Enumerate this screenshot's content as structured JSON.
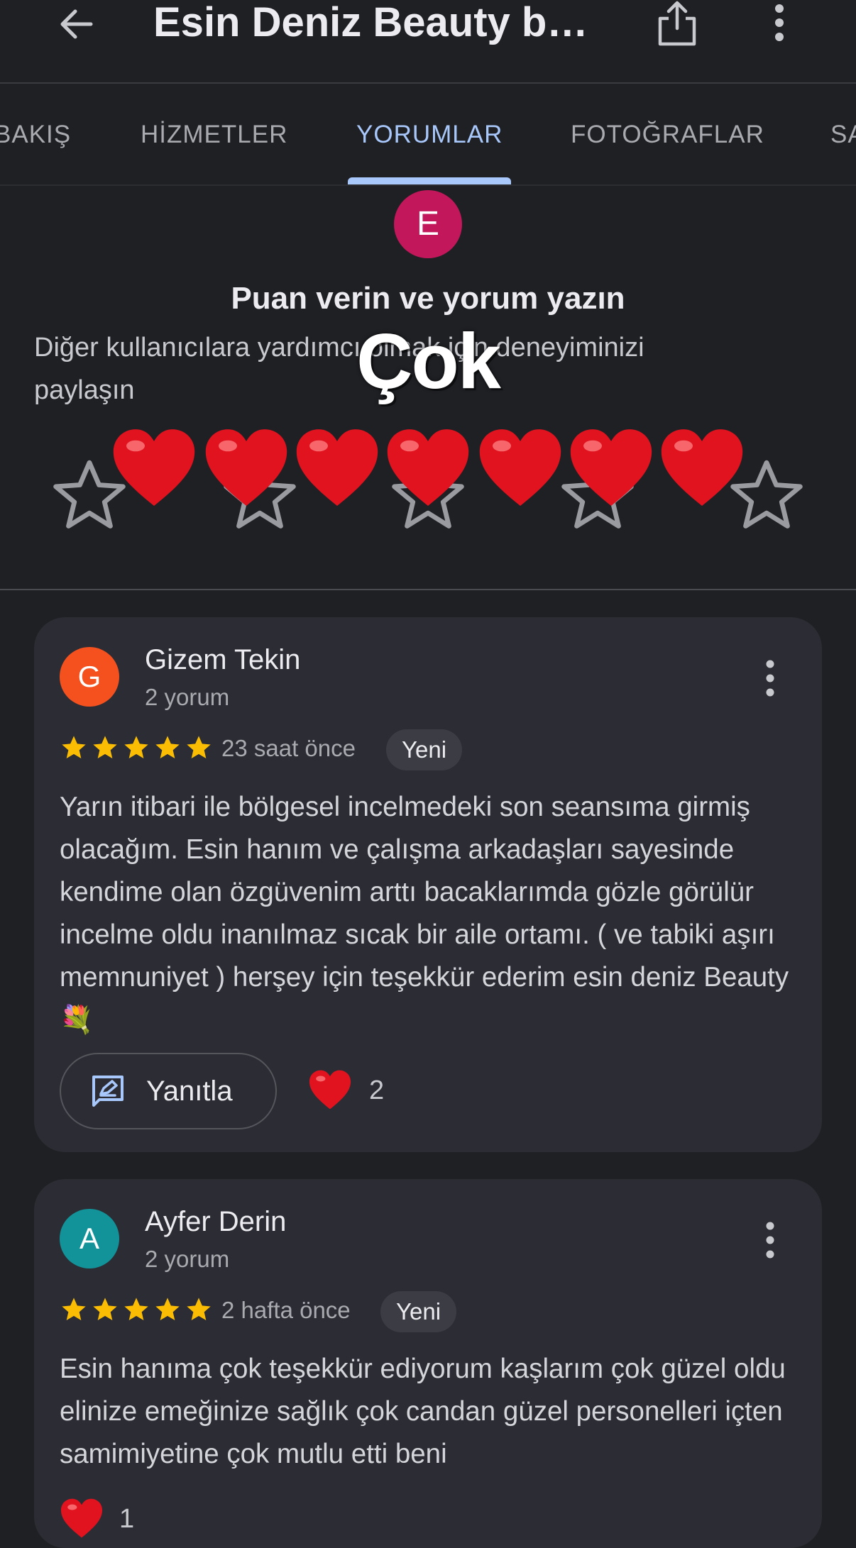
{
  "appbar": {
    "title": "Esin Deniz Beauty b…",
    "back_icon": "arrow-back-icon",
    "share_icon": "share-icon",
    "more_icon": "more-vert-icon"
  },
  "tabs": [
    {
      "label": "BAKIŞ",
      "active": false
    },
    {
      "label": "HİZMETLER",
      "active": false
    },
    {
      "label": "YORUMLAR",
      "active": true
    },
    {
      "label": "FOTOĞRAFLAR",
      "active": false
    },
    {
      "label": "SA",
      "active": false
    }
  ],
  "rate": {
    "avatar_letter": "E",
    "title": "Puan verin ve yorum yazın",
    "subtitle": "Diğer kullanıcılara yardımcı olmak için deneyiminizi paylaşın",
    "star_count": 5
  },
  "overlay": {
    "text": "Çok",
    "heart_count": 7
  },
  "colors": {
    "background": "#1f2024",
    "card": "#2c2d34",
    "accent": "#a8c7fa",
    "star": "#fbbc04",
    "heart": "#e0131f"
  },
  "reviews": [
    {
      "avatar_letter": "G",
      "avatar_color": "#f4511e",
      "name": "Gizem Tekin",
      "meta": "2 yorum",
      "rating": 5,
      "time": "23 saat önce",
      "badge": "Yeni",
      "text": "Yarın itibari ile bölgesel incelmedeki son seansıma girmiş olacağım. Esin hanım ve çalışma arkadaşları sayesinde kendime olan özgüvenim arttı bacaklarımda gözle görülür incelme oldu inanılmaz sıcak bir aile ortamı. ( ve tabiki aşırı memnuniyet ) herşey için teşekkür ederim esin deniz Beauty 💐",
      "reply_label": "Yanıtla",
      "like_count": "2"
    },
    {
      "avatar_letter": "A",
      "avatar_color": "#12939a",
      "name": "Ayfer Derin",
      "meta": "2 yorum",
      "rating": 5,
      "time": "2 hafta önce",
      "badge": "Yeni",
      "text": "Esin hanıma çok teşekkür ediyorum kaşlarım çok güzel oldu elinize emeğinize sağlık çok candan güzel personelleri içten samimiyetine çok mutlu etti beni",
      "like_count": "1"
    }
  ]
}
